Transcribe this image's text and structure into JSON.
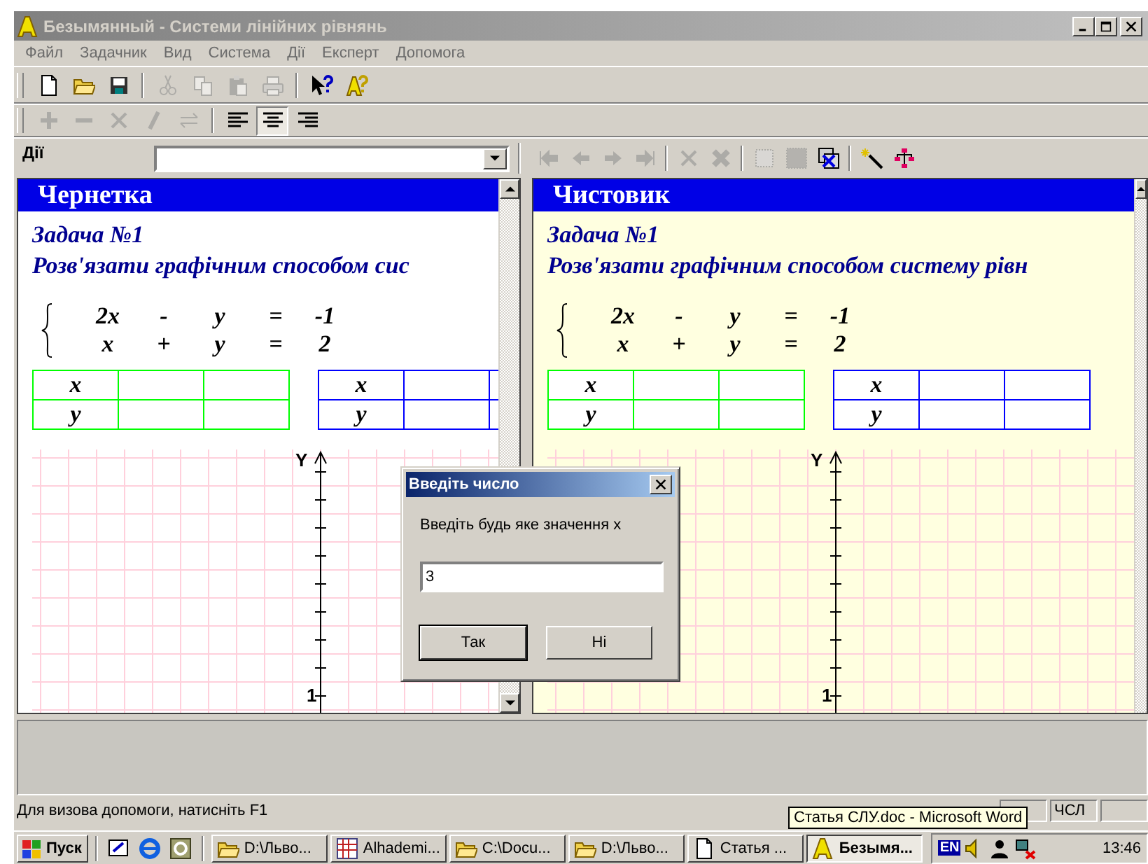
{
  "window": {
    "title": "Безымянный - Системи лінійних рівнянь",
    "active": false
  },
  "menu": [
    "Файл",
    "Задачник",
    "Вид",
    "Система",
    "Дії",
    "Експерт",
    "Допомога"
  ],
  "toolbar_file": [
    {
      "disabled": false
    },
    {
      "disabled": false
    },
    {
      "disabled": false
    },
    {
      "disabled": true
    },
    {
      "disabled": true
    },
    {
      "disabled": true
    },
    {
      "disabled": true
    },
    {
      "disabled": false
    },
    {
      "disabled": false
    }
  ],
  "toolbar_edit": [
    {
      "disabled": true,
      "selected": false
    },
    {
      "disabled": true,
      "selected": false
    },
    {
      "disabled": true,
      "selected": false
    },
    {
      "disabled": true,
      "selected": false
    },
    {
      "disabled": true,
      "selected": false
    },
    {
      "disabled": false,
      "selected": false
    },
    {
      "disabled": false,
      "selected": true
    },
    {
      "disabled": false,
      "selected": false
    }
  ],
  "actions": {
    "label": "Дії"
  },
  "toolbar_navigation": [
    {
      "disabled": true
    },
    {
      "disabled": true
    },
    {
      "disabled": true
    },
    {
      "disabled": true
    },
    {
      "disabled": true
    },
    {
      "disabled": true
    },
    {
      "disabled": true
    },
    {
      "disabled": true
    },
    {
      "disabled": false
    },
    {
      "disabled": false
    },
    {
      "disabled": false
    }
  ],
  "panes": [
    {
      "title": "Чернетка",
      "color": "#ffffff",
      "problem_title": "Задача №1",
      "problem_text": "Розв'язати графічним способом сис",
      "system": [
        [
          "2x",
          "-",
          "y",
          "=",
          "-1"
        ],
        [
          "x",
          "+",
          "y",
          "=",
          "2"
        ]
      ],
      "tables": [
        {
          "color": "#00ff00",
          "rows": [
            "x",
            "y"
          ]
        },
        {
          "color": "#0000ff",
          "rows": [
            "x",
            "y"
          ]
        }
      ],
      "graph": {
        "axis_label": "Y",
        "tick_label": "1"
      }
    },
    {
      "title": "Чистовик",
      "color": "#ffffe0",
      "problem_title": "Задача №1",
      "problem_text": "Розв'язати графічним способом систему рівн",
      "system": [
        [
          "2x",
          "-",
          "y",
          "=",
          "-1"
        ],
        [
          "x",
          "+",
          "y",
          "=",
          "2"
        ]
      ],
      "tables": [
        {
          "color": "#00ff00",
          "rows": [
            "x",
            "y"
          ]
        },
        {
          "color": "#0000ff",
          "rows": [
            "x",
            "y"
          ]
        }
      ],
      "graph": {
        "axis_label": "Y",
        "tick_label": "1"
      }
    }
  ],
  "dialog": {
    "title": "Введіть число",
    "prompt": "Введіть будь яке значення х",
    "value": "3",
    "buttons": [
      {
        "label": "Так",
        "default": true
      },
      {
        "label": "Ні",
        "default": false
      }
    ]
  },
  "status_bar": {
    "text": "Для визова допомоги, натисніть F1",
    "indicator": "ЧСЛ"
  },
  "taskbar": {
    "start": "Пуск",
    "tasks": [
      {
        "label": "D:\\Льво...",
        "selected": false
      },
      {
        "label": "Alhademi...",
        "selected": false
      },
      {
        "label": "C:\\Docu...",
        "selected": false
      },
      {
        "label": "D:\\Льво...",
        "selected": false
      },
      {
        "label": "Статья ...",
        "selected": false
      },
      {
        "label": "Безымя...",
        "selected": true
      }
    ],
    "language": "EN",
    "clock": "13:46"
  },
  "tooltip": "Статья СЛУ.doc - Microsoft Word"
}
